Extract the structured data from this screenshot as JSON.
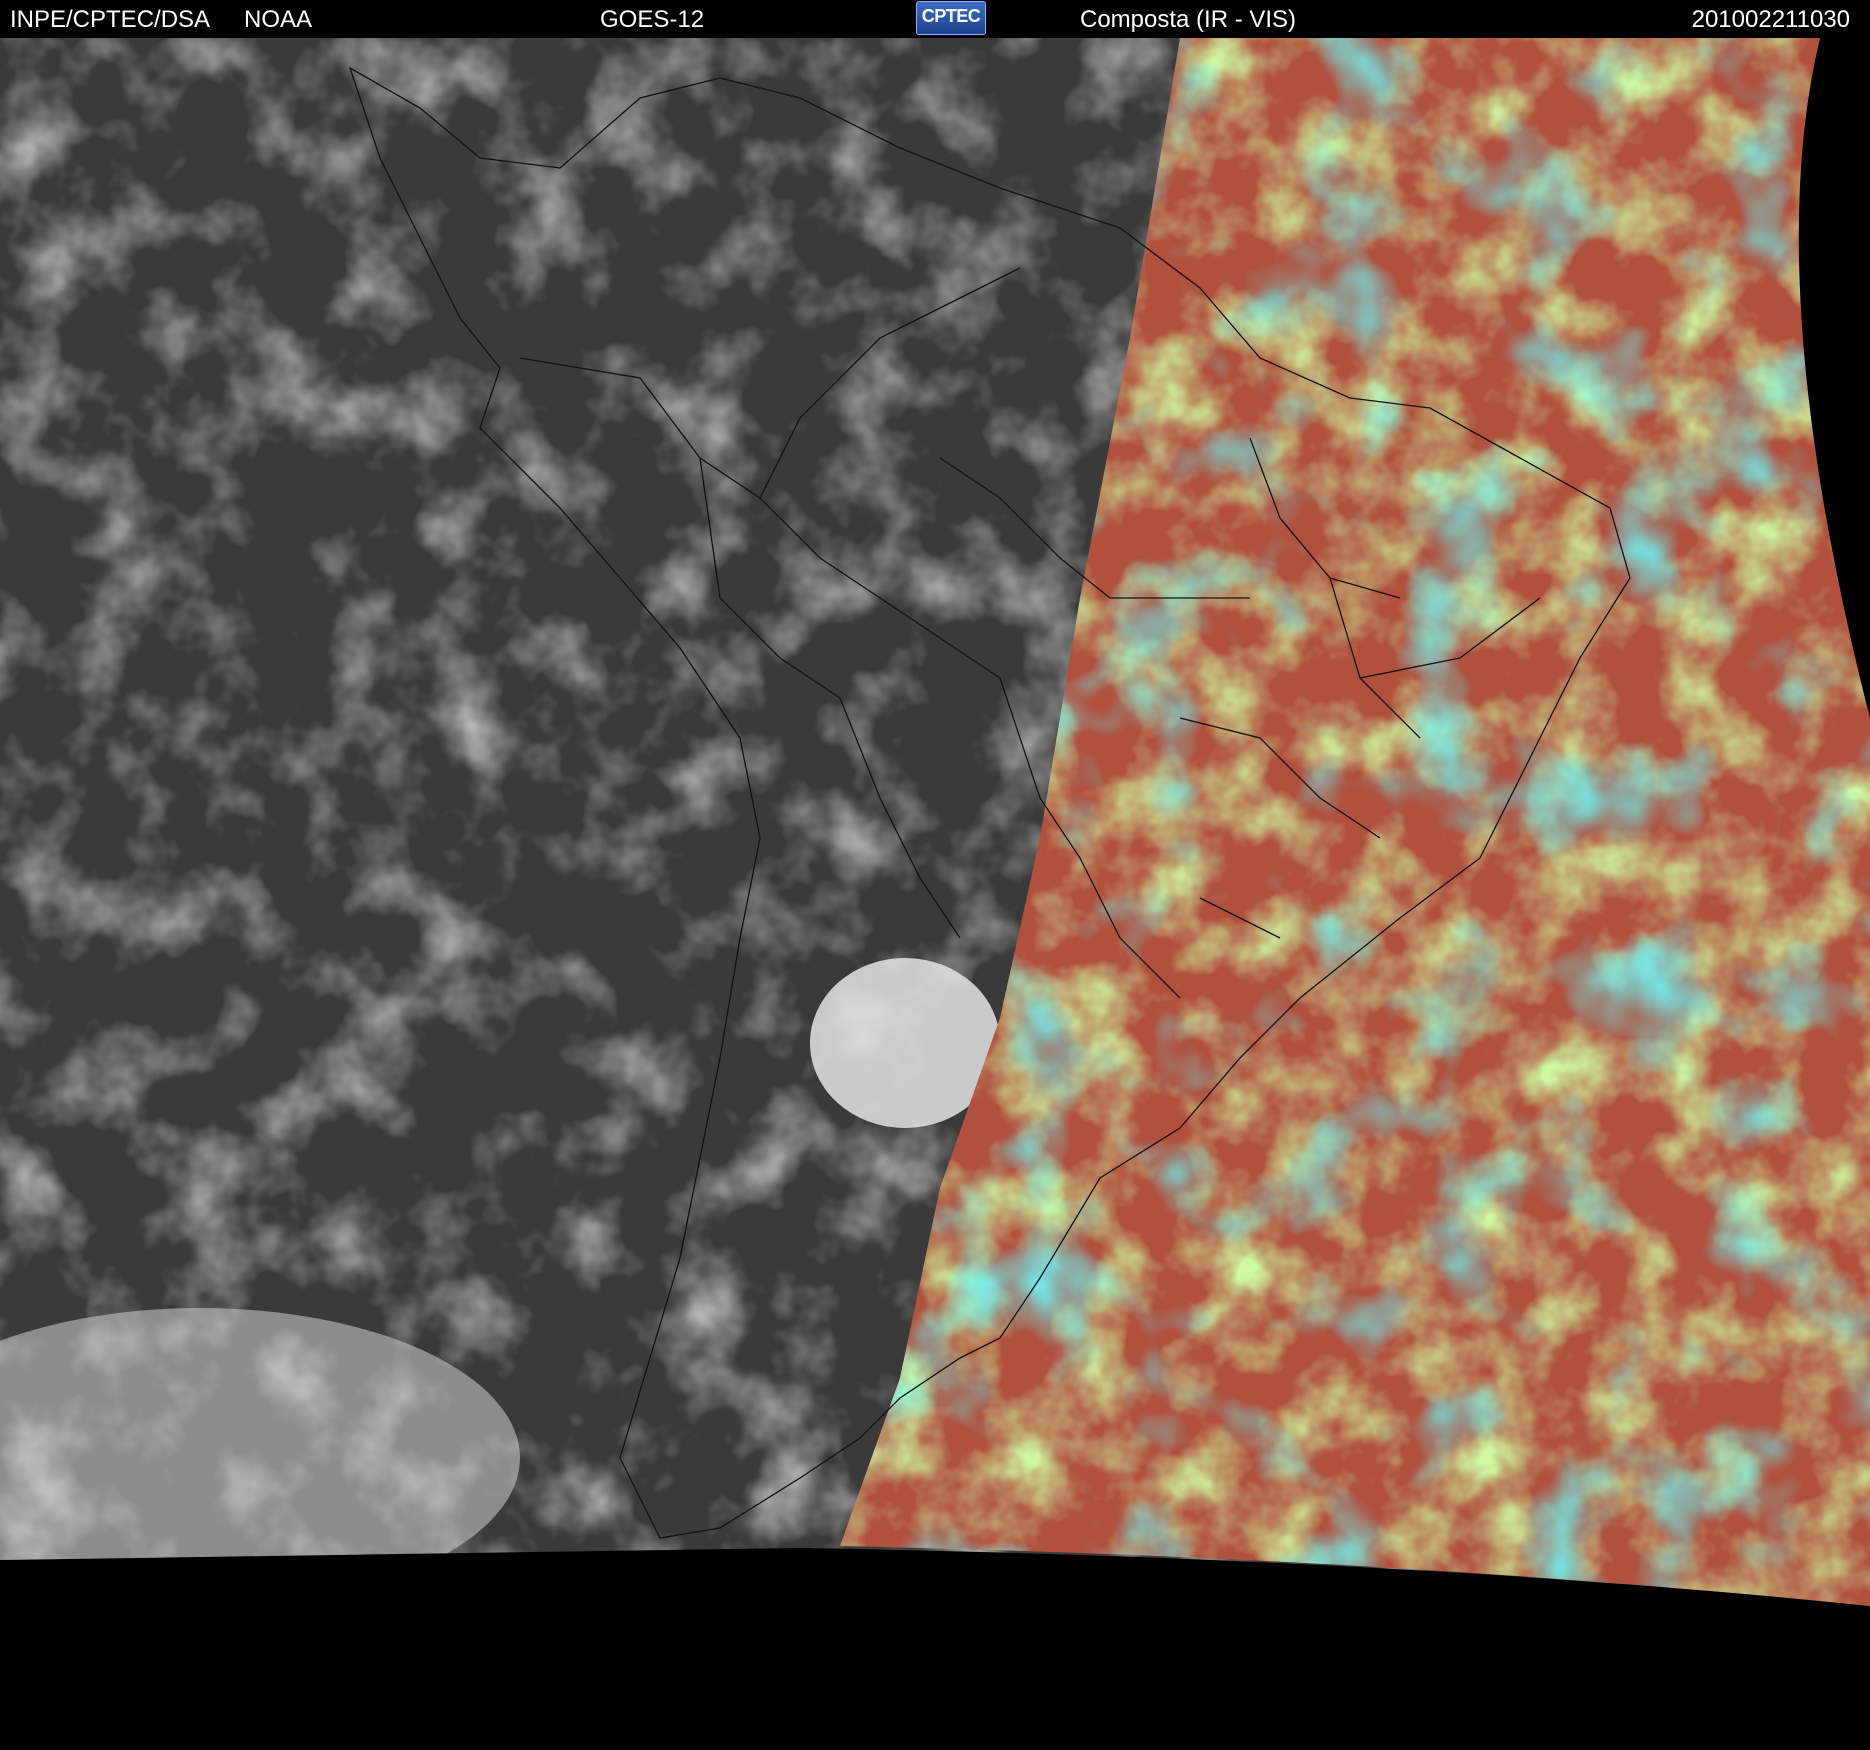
{
  "header": {
    "org": "INPE/CPTEC/DSA",
    "agency": "NOAA",
    "satellite": "GOES-12",
    "product": "Composta (IR - VIS)",
    "timestamp": "201002211030"
  },
  "logo": {
    "text": "CPTEC"
  },
  "imagery": {
    "left_panel": "infrared-grayscale",
    "right_panel": "false-color-composite",
    "colors": {
      "space": "#000000",
      "ir_background": "#3a3a3a",
      "ir_clouds": "#d9d9d9",
      "vis_red": "#b0503d",
      "vis_green": "#9ef05a",
      "vis_cyan": "#28e4e6",
      "coastline": "#111111"
    }
  }
}
